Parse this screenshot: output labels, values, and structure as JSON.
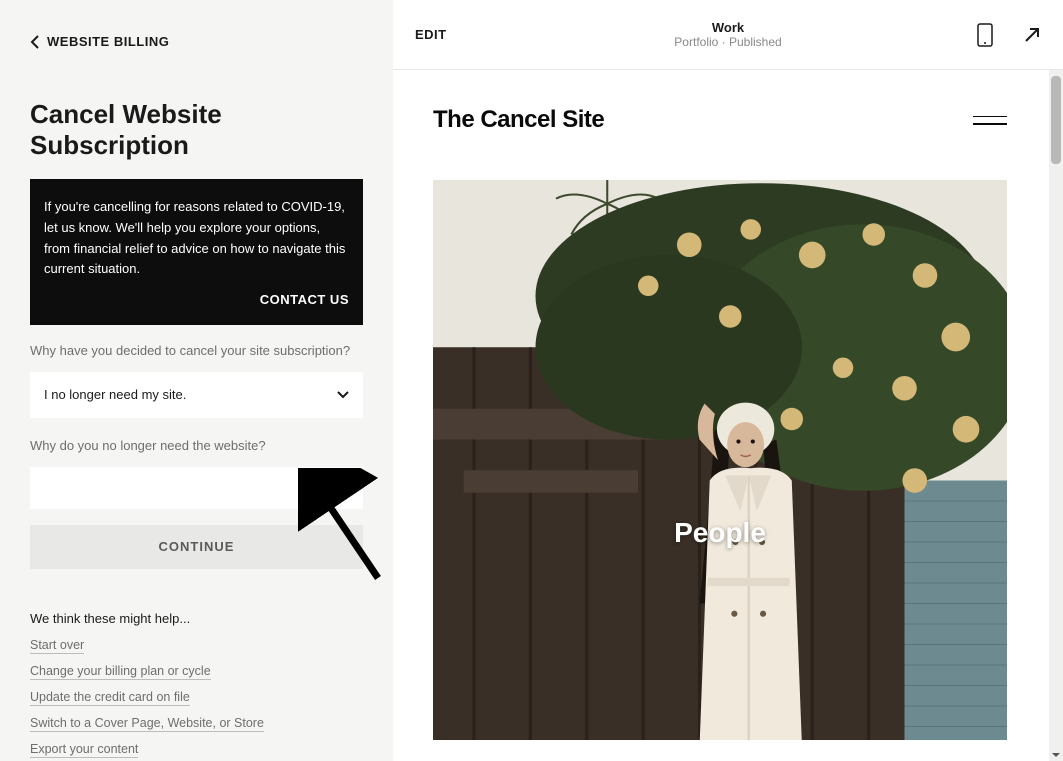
{
  "back_label": "WEBSITE BILLING",
  "page_title": "Cancel Website Subscription",
  "notice": {
    "text": "If you're cancelling for reasons related to COVID-19, let us know. We'll help you explore your options, from financial relief to advice on how to navigate this current situation.",
    "contact_label": "CONTACT US"
  },
  "reason_label": "Why have you decided to cancel your site subscription?",
  "reason_selected": "I no longer need my site.",
  "followup_label": "Why do you no longer need the website?",
  "followup_value": "",
  "continue_label": "CONTINUE",
  "help_title": "We think these might help...",
  "help_links": [
    "Start over",
    "Change your billing plan or cycle",
    "Update the credit card on file",
    "Switch to a Cover Page, Website, or Store",
    "Export your content"
  ],
  "preview": {
    "edit_label": "EDIT",
    "title": "Work",
    "subtitle": "Portfolio · Published",
    "site_brand": "The Cancel Site",
    "hero_label": "People"
  }
}
